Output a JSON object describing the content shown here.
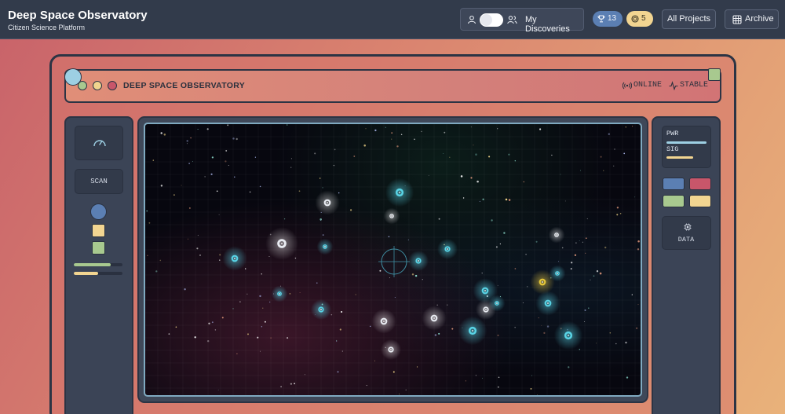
{
  "header": {
    "title": "Deep Space Observatory",
    "subtitle": "Citizen Science Platform",
    "mode_label": "My Discoveries",
    "trophy_count": "13",
    "coin_count": "5",
    "projects_label": "All Projects",
    "archive_label": "Archive"
  },
  "console": {
    "title": "DEEP SPACE OBSERVATORY",
    "status_online": "ONLINE",
    "status_stable": "STABLE",
    "scan_label": "SCAN",
    "pwr_label": "PWR",
    "sig_label": "SIG",
    "data_label": "DATA",
    "left_bars": [
      {
        "color": "#a8c98f",
        "level": 0.75
      },
      {
        "color": "#f2d591",
        "level": 0.5
      }
    ],
    "right_levels": {
      "pwr": 1.0,
      "sig": 0.67
    },
    "swatches": [
      "#5b7fb3",
      "#c8566a",
      "#a8c98f",
      "#f2d591"
    ]
  },
  "colors": {
    "header_bg": "#323b4b",
    "accent_cyan": "#59d4e6",
    "accent_blue": "#5b7fb3",
    "accent_yellow": "#f2d591",
    "accent_green": "#a8c98f",
    "accent_red": "#c8566a"
  },
  "icons": {
    "user": "user-icon",
    "group": "users-icon",
    "trophy": "trophy-icon",
    "coin": "coin-icon",
    "archive": "grid-icon",
    "online": "radio-signal-icon",
    "stable": "activity-icon",
    "gauge": "gauge-icon",
    "data": "chip-icon"
  }
}
